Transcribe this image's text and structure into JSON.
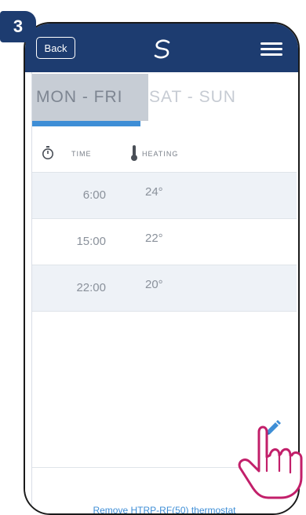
{
  "step": {
    "number": "3"
  },
  "header": {
    "back_label": "Back"
  },
  "tabs": [
    {
      "label": "MON - FRI",
      "active": true
    },
    {
      "label": "SAT - SUN",
      "active": false
    }
  ],
  "table": {
    "headers": {
      "time": "TIME",
      "heating": "HEATING"
    },
    "rows": [
      {
        "time": "6:00",
        "temp": "24°"
      },
      {
        "time": "15:00",
        "temp": "22°"
      },
      {
        "time": "22:00",
        "temp": "20°"
      }
    ]
  },
  "footer": {
    "remove_label": "Remove HTRP-RF(50) thermostat"
  },
  "colors": {
    "brand": "#1d3c70",
    "accent": "#3e8ed6",
    "tab_active_bg": "#c7cdd5",
    "row_shade": "#eef2f7"
  },
  "icons": {
    "menu": "hamburger-icon",
    "logo": "brand-logo-icon",
    "timer": "timer-icon",
    "heating": "thermometer-icon",
    "edit": "pencil-icon",
    "pointer": "hand-pointer-icon"
  }
}
